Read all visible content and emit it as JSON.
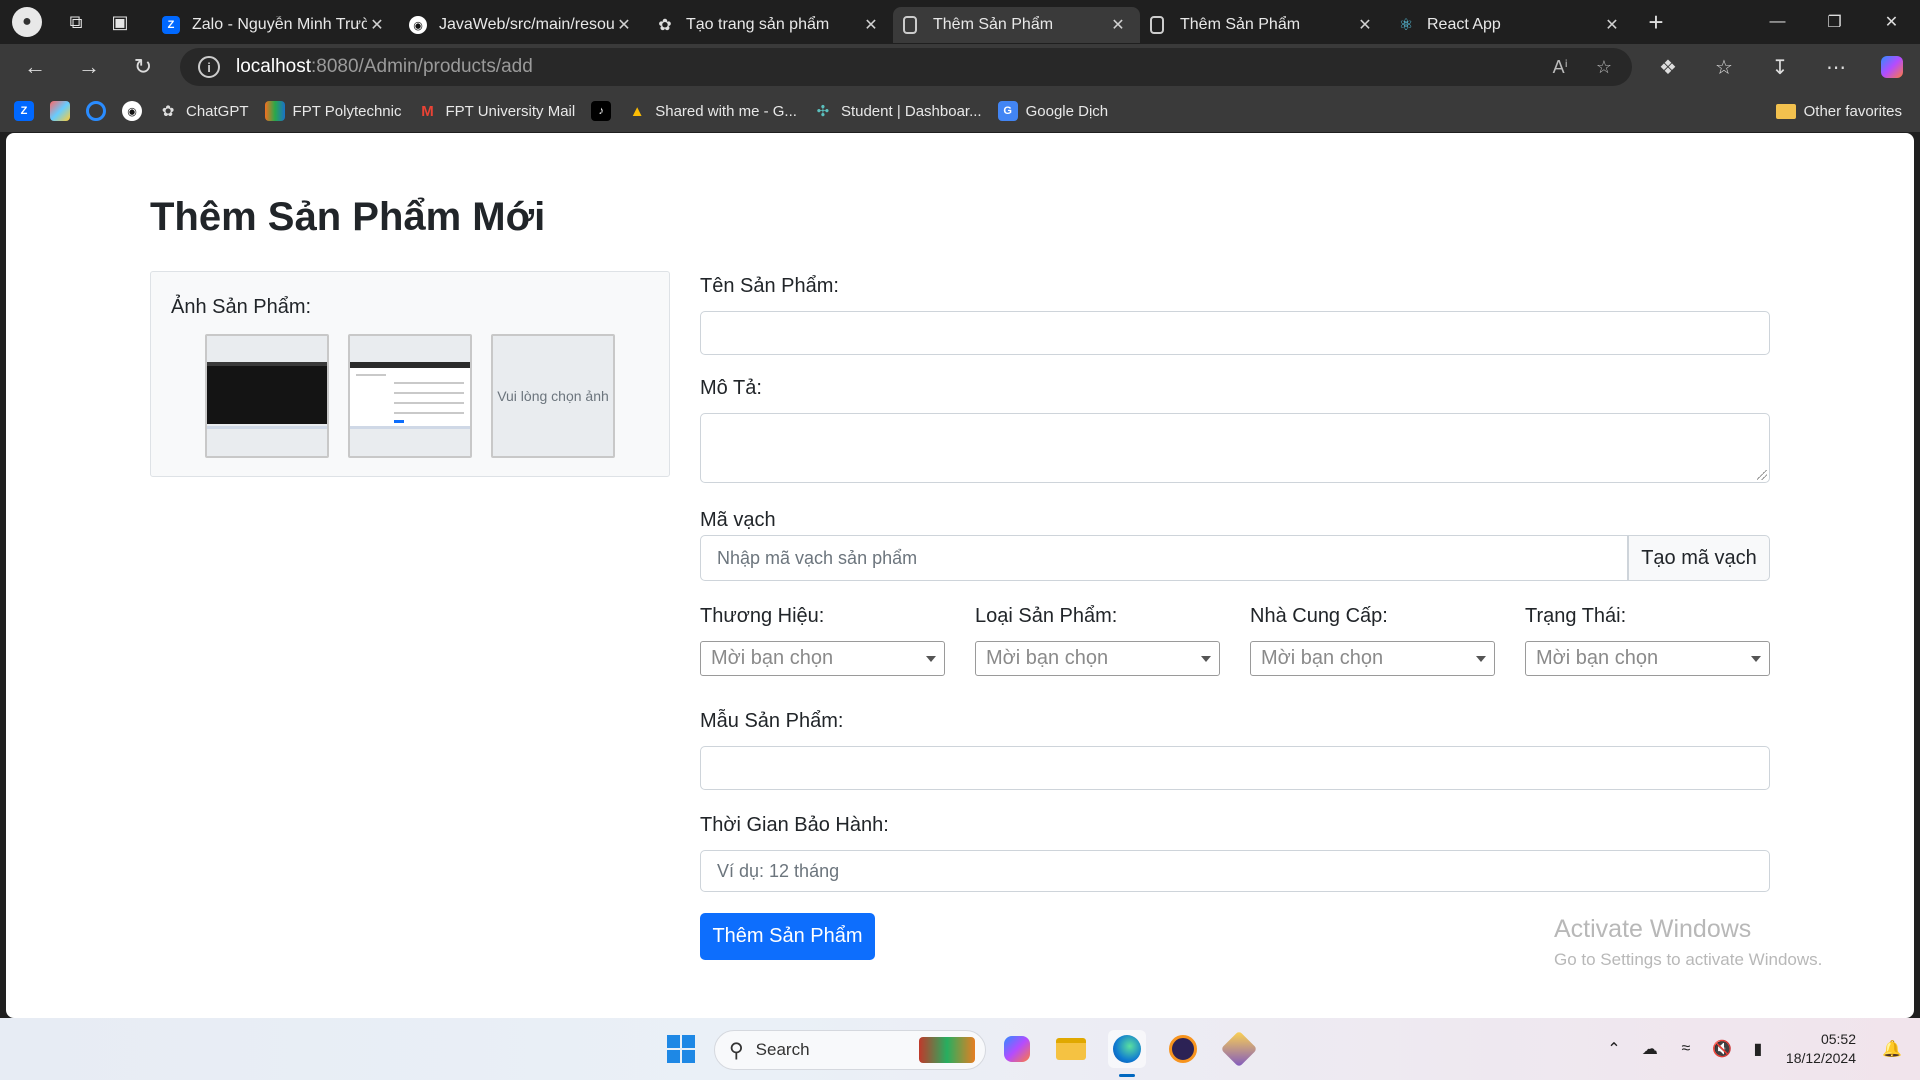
{
  "browser": {
    "tabs": [
      {
        "title": "Zalo - Nguyễn Minh Trườ",
        "favicon": "zalo-icon",
        "active": false
      },
      {
        "title": "JavaWeb/src/main/resour",
        "favicon": "github-icon",
        "active": false
      },
      {
        "title": "Tạo trang sản phẩm",
        "favicon": "chatgpt-icon",
        "active": false
      },
      {
        "title": "Thêm Sản Phẩm",
        "favicon": "page-icon",
        "active": true
      },
      {
        "title": "Thêm Sản Phẩm",
        "favicon": "page-icon",
        "active": false
      },
      {
        "title": "React App",
        "favicon": "react-icon",
        "active": false
      }
    ],
    "url_host": "localhost",
    "url_path": ":8080/Admin/products/add",
    "bookmarks": [
      {
        "label": "",
        "icon": "zalo-icon"
      },
      {
        "label": "",
        "icon": "colorful-icon"
      },
      {
        "label": "",
        "icon": "circle-icon"
      },
      {
        "label": "",
        "icon": "github-icon"
      },
      {
        "label": "ChatGPT",
        "icon": "chatgpt-icon"
      },
      {
        "label": "FPT Polytechnic",
        "icon": "fpt-icon"
      },
      {
        "label": "FPT University Mail",
        "icon": "gmail-icon"
      },
      {
        "label": "",
        "icon": "tiktok-icon"
      },
      {
        "label": "Shared with me - G...",
        "icon": "drive-icon"
      },
      {
        "label": "Student | Dashboar...",
        "icon": "dashboard-icon"
      },
      {
        "label": "Google Dịch",
        "icon": "translate-icon"
      }
    ],
    "other_favorites": "Other favorites"
  },
  "page": {
    "title": "Thêm Sản Phẩm Mới",
    "image_section": {
      "label": "Ảnh Sản Phẩm:",
      "placeholder_text": "Vui lòng chọn ảnh"
    },
    "fields": {
      "name_label": "Tên Sản Phẩm:",
      "name_value": "",
      "description_label": "Mô Tả:",
      "description_value": "",
      "barcode_label": "Mã vạch",
      "barcode_placeholder": "Nhập mã vạch sản phẩm",
      "barcode_button": "Tạo mã vạch",
      "brand_label": "Thương Hiệu:",
      "category_label": "Loại Sản Phẩm:",
      "supplier_label": "Nhà Cung Cấp:",
      "status_label": "Trạng Thái:",
      "select_placeholder": "Mời bạn chọn",
      "model_label": "Mẫu Sản Phẩm:",
      "model_value": "",
      "warranty_label": "Thời Gian Bảo Hành:",
      "warranty_placeholder": "Ví dụ: 12 tháng"
    },
    "submit_button": "Thêm Sản Phẩm",
    "watermark_line1": "Activate Windows",
    "watermark_line2": "Go to Settings to activate Windows."
  },
  "taskbar": {
    "search_label": "Search",
    "time": "05:52",
    "date": "18/12/2024"
  },
  "colors": {
    "primary": "#0d6efd",
    "browser_dark": "#1f1f1f",
    "browser_toolbar": "#3a3a3a"
  }
}
